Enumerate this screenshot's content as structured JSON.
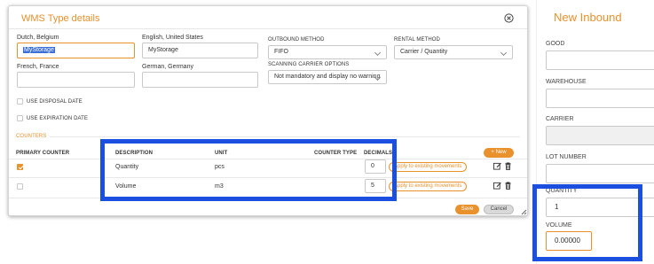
{
  "modal": {
    "title": "WMS Type details",
    "close_icon": "close-circle-icon",
    "fields": {
      "dutch_label": "Dutch, Belgium",
      "dutch_value": "MyStorage",
      "english_label": "English, United States",
      "english_value": "MyStorage",
      "french_label": "French, France",
      "french_value": "",
      "german_label": "German, Germany",
      "german_value": ""
    },
    "outbound_method": {
      "label": "OUTBOUND METHOD",
      "value": "FIFO"
    },
    "rental_method": {
      "label": "RENTAL METHOD",
      "value": "Carrier / Quantity"
    },
    "scanning_carrier": {
      "label": "SCANNING CARRIER OPTIONS",
      "value": "Not mandatory and display no warning"
    },
    "use_disposal_date": "USE DISPOSAL DATE",
    "use_expiration_date": "USE EXPIRATION DATE",
    "counters_section": "COUNTERS",
    "new_button": "+ New",
    "table": {
      "headers": {
        "primary": "PRIMARY COUNTER",
        "description": "DESCRIPTION",
        "unit": "UNIT",
        "counter_type": "COUNTER TYPE",
        "decimals": "DECIMALS"
      },
      "rows": [
        {
          "primary": true,
          "description": "Quantity",
          "unit": "pcs",
          "decimals": "0",
          "apply": "Apply to existing movements"
        },
        {
          "primary": false,
          "description": "Volume",
          "unit": "m3",
          "decimals": "5",
          "apply": "Apply to existing movements"
        }
      ]
    },
    "save_button": "Save",
    "cancel_button": "Cancel"
  },
  "right_panel": {
    "title": "New Inbound",
    "good_label": "GOOD",
    "warehouse_label": "WAREHOUSE",
    "carrier_label": "CARRIER",
    "lot_number_label": "LOT NUMBER",
    "quantity_label": "QUANTITY",
    "quantity_value": "1",
    "volume_label": "VOLUME",
    "volume_value": "0.00000"
  },
  "colors": {
    "accent": "#e8912d",
    "highlight": "#1a4fe0",
    "selection": "#3b6fd6"
  }
}
